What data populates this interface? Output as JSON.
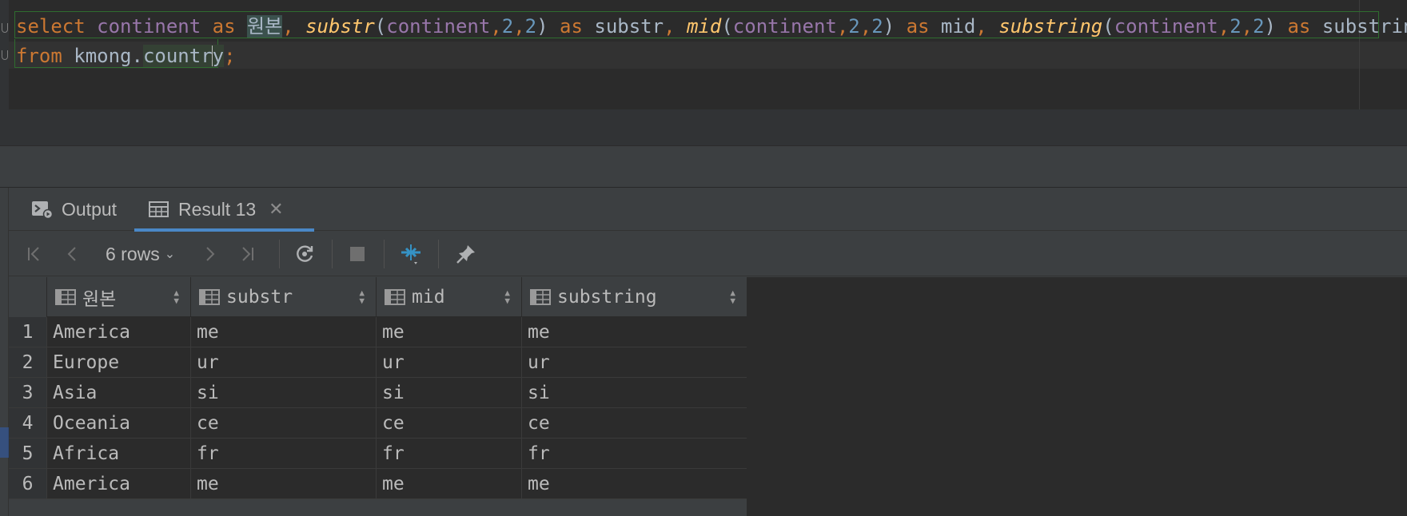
{
  "editor": {
    "line1": {
      "t1": "select",
      "t2": "continent",
      "t3": "as",
      "t4": "원본",
      "t5": ",",
      "t6": "substr",
      "t7": "(",
      "t8": "continent",
      "t9": ",",
      "t10": "2",
      "t11": ",",
      "t12": "2",
      "t13": ")",
      "t14": "as",
      "t15": "substr",
      "t16": ",",
      "t17": "mid",
      "t18": "(",
      "t19": "continent",
      "t20": ",",
      "t21": "2",
      "t22": ",",
      "t23": "2",
      "t24": ")",
      "t25": "as",
      "t26": "mid",
      "t27": ",",
      "t28": "substring",
      "t29": "(",
      "t30": "continent",
      "t31": ",",
      "t32": "2",
      "t33": ",",
      "t34": "2",
      "t35": ")",
      "t36": "as",
      "t37": "substring"
    },
    "line2": {
      "t1": "from",
      "t2": "kmong.",
      "t3": "countr",
      "t4": "y",
      "t5": ";"
    }
  },
  "tabs": {
    "output_label": "Output",
    "result_label": "Result 13",
    "result_close": "✕"
  },
  "toolbar": {
    "rows_label": "6 rows",
    "rows_chevron": "⌄"
  },
  "grid": {
    "columns": [
      "원본",
      "substr",
      "mid",
      "substring"
    ],
    "rows": [
      {
        "num": "1",
        "cells": [
          "America",
          "me",
          "me",
          "me"
        ]
      },
      {
        "num": "2",
        "cells": [
          "Europe",
          "ur",
          "ur",
          "ur"
        ]
      },
      {
        "num": "3",
        "cells": [
          "Asia",
          "si",
          "si",
          "si"
        ]
      },
      {
        "num": "4",
        "cells": [
          "Oceania",
          "ce",
          "ce",
          "ce"
        ]
      },
      {
        "num": "5",
        "cells": [
          "Africa",
          "fr",
          "fr",
          "fr"
        ]
      },
      {
        "num": "6",
        "cells": [
          "America",
          "me",
          "me",
          "me"
        ]
      }
    ]
  },
  "colors": {
    "keyword": "#cc7832",
    "column": "#9876aa",
    "function": "#ffc66d",
    "number": "#6897bb",
    "text": "#a9b7c6",
    "accent": "#4a88c7"
  },
  "icons": {
    "output_tab": "console-run-icon",
    "result_tab": "table-icon",
    "toolbar": [
      "first-page-icon",
      "previous-page-icon",
      "next-page-icon",
      "last-page-icon",
      "reload-icon",
      "stop-icon",
      "compare-icon",
      "pin-icon"
    ],
    "column_header": "column-table-icon",
    "sort": "sort-arrows-icon"
  }
}
